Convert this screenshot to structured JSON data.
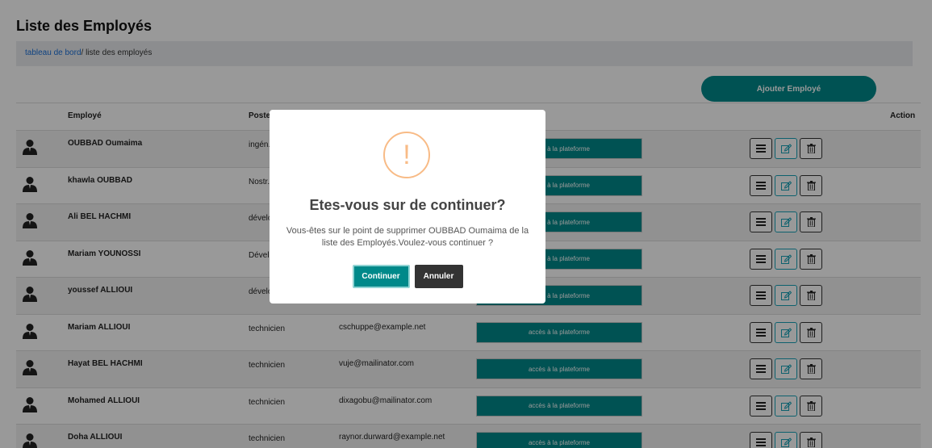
{
  "page": {
    "title": "Liste des Employés",
    "breadcrumb": {
      "link": "tableau de bord",
      "current": "/ liste des employés"
    },
    "add_button": "Ajouter Employé"
  },
  "table": {
    "headers": {
      "employee": "Employé",
      "poste": "Poste",
      "action": "Action"
    },
    "rows": [
      {
        "name": "OUBBAD Oumaima",
        "poste": "ingén... inform...",
        "email": "",
        "access": "accès à la plateforme"
      },
      {
        "name": "khawla OUBBAD",
        "poste": "Nostr...",
        "email": "",
        "access": "accès à la plateforme"
      },
      {
        "name": "Ali BEL HACHMI",
        "poste": "dévelo...",
        "email": "",
        "access": "accès à la plateforme"
      },
      {
        "name": "Mariam YOUNOSSI",
        "poste": "Dével...",
        "email": "",
        "access": "accès à la plateforme"
      },
      {
        "name": "youssef ALLIOUI",
        "poste": "dévelo...",
        "email": "",
        "access": "accès à la plateforme"
      },
      {
        "name": "Mariam ALLIOUI",
        "poste": "technicien",
        "email": "cschuppe@example.net",
        "access": "accès à la plateforme"
      },
      {
        "name": "Hayat BEL HACHMI",
        "poste": "technicien",
        "email": "vuje@mailinator.com",
        "access": "accès à la plateforme"
      },
      {
        "name": "Mohamed ALLIOUI",
        "poste": "technicien",
        "email": "dixagobu@mailinator.com",
        "access": "accès à la plateforme"
      },
      {
        "name": "Doha ALLIOUI",
        "poste": "technicien",
        "email": "raynor.durward@example.net",
        "access": "accès à la plateforme"
      }
    ]
  },
  "modal": {
    "icon": "!",
    "title": "Etes-vous sur de continuer?",
    "text": "Vous-êtes sur le point de supprimer OUBBAD Oumaima de la liste des Employés.Voulez-vous continuer ?",
    "confirm": "Continuer",
    "cancel": "Annuler"
  },
  "colors": {
    "accent": "#00898a",
    "warning": "#f8bb86",
    "dark": "#333333"
  }
}
